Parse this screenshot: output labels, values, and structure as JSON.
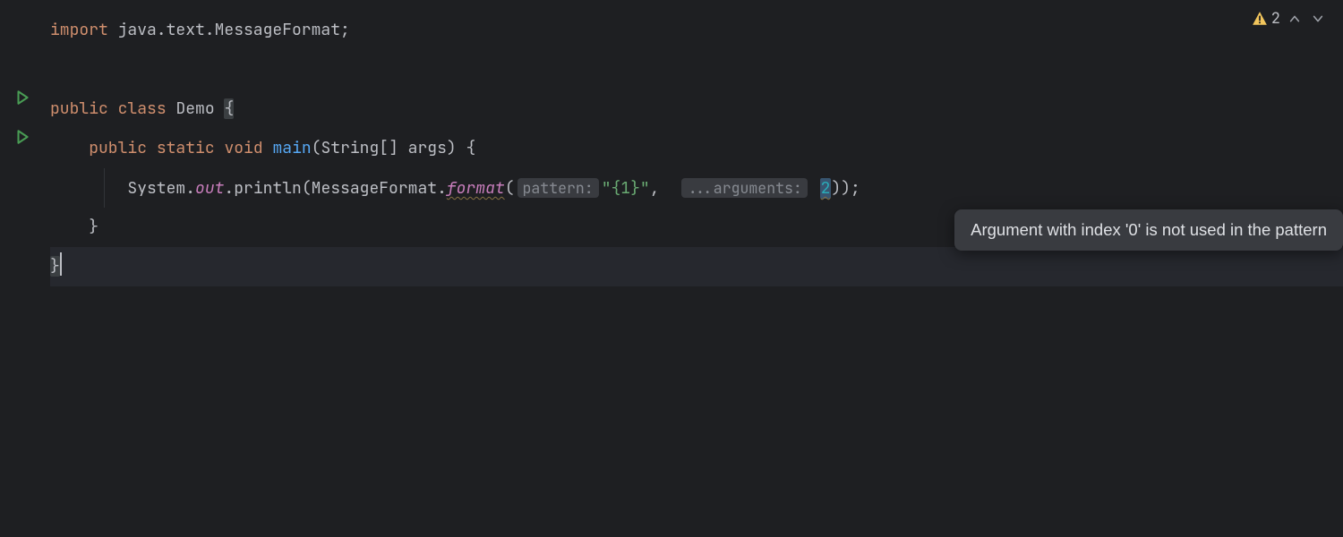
{
  "inspections": {
    "warning_count": "2"
  },
  "code": {
    "line1": {
      "kw_import": "import",
      "pkg": " java.text.MessageFormat;"
    },
    "line3": {
      "kw_public": "public",
      "kw_class": "class",
      "class_name": "Demo",
      "brace": "{"
    },
    "line4": {
      "kw_public": "public",
      "kw_static": "static",
      "kw_void": "void",
      "method_name": "main",
      "params_open": "(",
      "param_type": "String[] args",
      "params_close": ")",
      "brace": " {"
    },
    "line5": {
      "receiver": "System.",
      "field_out": "out",
      "dot": ".",
      "println": "println",
      "open": "(",
      "mf_class": "MessageFormat",
      "dot2": ".",
      "format_m": "format",
      "open2": "(",
      "hint_pattern": "pattern:",
      "str_pattern": "\"{1}\"",
      "comma": ",  ",
      "hint_args": "...arguments:",
      "arg_val": "2",
      "close": "));"
    },
    "line6": {
      "brace": "    }"
    },
    "line7": {
      "brace": "}"
    }
  },
  "tooltip": {
    "text": "Argument with index '0' is not used in the pattern"
  }
}
